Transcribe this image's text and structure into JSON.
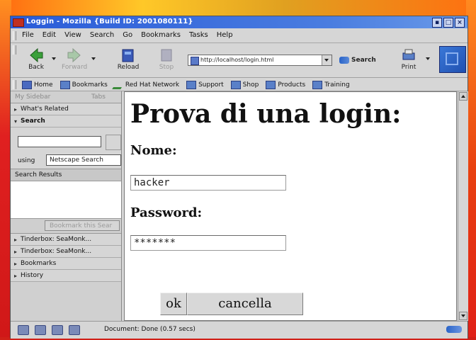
{
  "window": {
    "title": "Loggin - Mozilla {Build ID: 2001080111}",
    "controls": [
      "▪",
      "□",
      "×"
    ]
  },
  "menubar": {
    "items": [
      "File",
      "Edit",
      "View",
      "Search",
      "Go",
      "Bookmarks",
      "Tasks",
      "Help"
    ]
  },
  "navigation": {
    "back": "Back",
    "forward": "Forward",
    "reload": "Reload",
    "stop": "Stop",
    "url": "http://localhost/login.html",
    "search": "Search",
    "print": "Print"
  },
  "personal_toolbar": {
    "items": [
      "Home",
      "Bookmarks",
      "Red Hat Network",
      "Support",
      "Shop",
      "Products",
      "Training"
    ]
  },
  "sidebar": {
    "tab_left": "My Sidebar",
    "tab_right": "Tabs",
    "whats_related": "What's Related",
    "search_header": "Search",
    "using_label": "using",
    "engine": "Netscape Search",
    "results_header": "Search Results",
    "bookmark_button": "Bookmark this Sear",
    "bottom_items": [
      "Tinderbox: SeaMonk...",
      "Tinderbox: SeaMonk...",
      "Bookmarks",
      "History"
    ]
  },
  "page": {
    "heading": "Prova di una login:",
    "name_label": "Nome:",
    "name_value": "hacker",
    "password_label": "Password:",
    "password_value": "*******",
    "ok_button": "ok",
    "cancel_button": "cancella"
  },
  "status": {
    "text": "Document: Done (0.57 secs)"
  }
}
